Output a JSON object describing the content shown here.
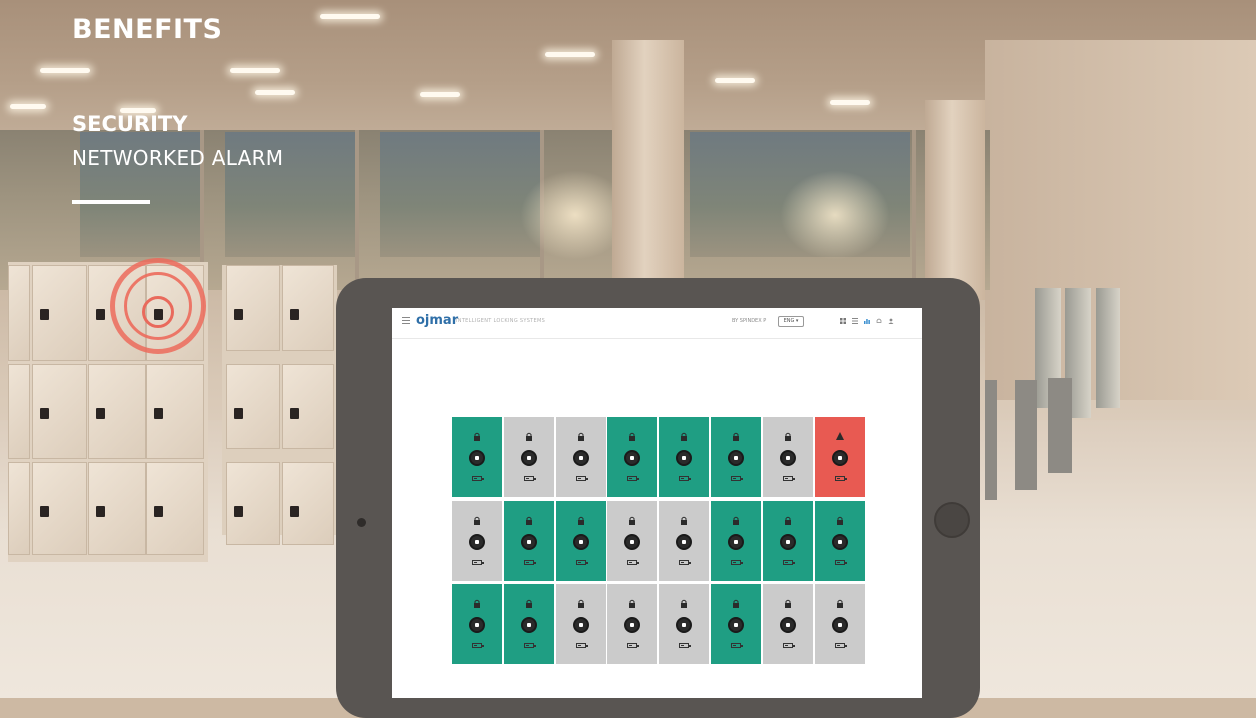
{
  "heading": {
    "section": "BENEFITS",
    "topic": "SECURITY",
    "subtopic": "NETWORKED ALARM"
  },
  "tablet_app": {
    "logo": "ojmar",
    "tagline": "INTELLIGENT LOCKING SYSTEMS",
    "user": "BY SPINDEX P",
    "language": "ENG ▾",
    "menu_icon": "hamburger-icon",
    "toolbar_icons": [
      "grid-icon",
      "list-icon",
      "chart-icon",
      "bell-icon",
      "user-icon"
    ]
  },
  "locker_grid": {
    "rows": [
      [
        "available",
        "occupied",
        "occupied",
        "available",
        "available",
        "available",
        "occupied",
        "alarm"
      ],
      [
        "occupied",
        "available",
        "available",
        "occupied",
        "occupied",
        "available",
        "available",
        "available"
      ],
      [
        "available",
        "available",
        "occupied",
        "occupied",
        "occupied",
        "available",
        "occupied",
        "occupied"
      ]
    ],
    "colors": {
      "available": "#1f9e83",
      "occupied": "#cbcbcb",
      "alarm": "#e85a52"
    }
  },
  "colors": {
    "alarm_ring": "#e96a5c",
    "tablet_frame": "#595552"
  }
}
